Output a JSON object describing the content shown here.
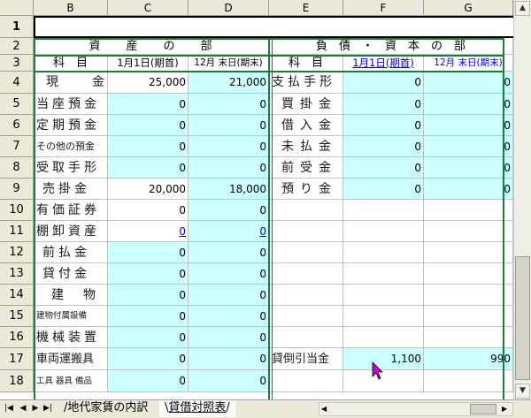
{
  "columns": [
    "B",
    "C",
    "D",
    "E",
    "F",
    "G"
  ],
  "rows": [
    {
      "num": "1"
    },
    {
      "num": "2",
      "b": "資　　産　　の　　部",
      "e": "負　債　・　資　本　の　部"
    },
    {
      "num": "3",
      "b": "科　目",
      "c": "1月1日(期首)",
      "d": "12月 末日(期末)",
      "e": "科　目",
      "f": "1月1日(期首)",
      "g": "12月 末日(期末)"
    },
    {
      "num": "4",
      "b": "現　金",
      "c": "25,000",
      "d": "21,000",
      "e": "支払手形",
      "f": "0",
      "g": "0"
    },
    {
      "num": "5",
      "b": "当座預金",
      "c": "0",
      "d": "0",
      "e": "買掛金",
      "f": "0",
      "g": "0"
    },
    {
      "num": "6",
      "b": "定期預金",
      "c": "0",
      "d": "0",
      "e": "借入金",
      "f": "0",
      "g": "0"
    },
    {
      "num": "7",
      "b": "その他の預金",
      "c": "0",
      "d": "0",
      "e": "未払金",
      "f": "0",
      "g": "0"
    },
    {
      "num": "8",
      "b": "受取手形",
      "c": "0",
      "d": "0",
      "e": "前受金",
      "f": "0",
      "g": "0"
    },
    {
      "num": "9",
      "b": "売掛金",
      "c": "20,000",
      "d": "18,000",
      "e": "預り金",
      "f": "0",
      "g": "0"
    },
    {
      "num": "10",
      "b": "有価証券",
      "c": "0",
      "d": "0"
    },
    {
      "num": "11",
      "b": "棚卸資産",
      "c": "0",
      "d": "0"
    },
    {
      "num": "12",
      "b": "前払金",
      "c": "0",
      "d": "0"
    },
    {
      "num": "13",
      "b": "貸付金",
      "c": "0",
      "d": "0"
    },
    {
      "num": "14",
      "b": "建　物",
      "c": "0",
      "d": "0"
    },
    {
      "num": "15",
      "b": "建物付属設備",
      "c": "0",
      "d": "0"
    },
    {
      "num": "16",
      "b": "機械装置",
      "c": "0",
      "d": "0"
    },
    {
      "num": "17",
      "b": "車両運搬具",
      "c": "0",
      "d": "0",
      "e": "貸倒引当金",
      "f": "1,100",
      "g": "990"
    },
    {
      "num": "18",
      "b": "工具 器具 備品",
      "c": "0",
      "d": "0"
    }
  ],
  "tabs": [
    "地代家賃の内訳",
    "貸借対照表"
  ],
  "active_tab": "貸借対照表",
  "colors": {
    "cyan": "#ccffff",
    "green_border": "#1d7a3a",
    "link_blue": "#0000cc",
    "cursor": "#cc00cc"
  }
}
